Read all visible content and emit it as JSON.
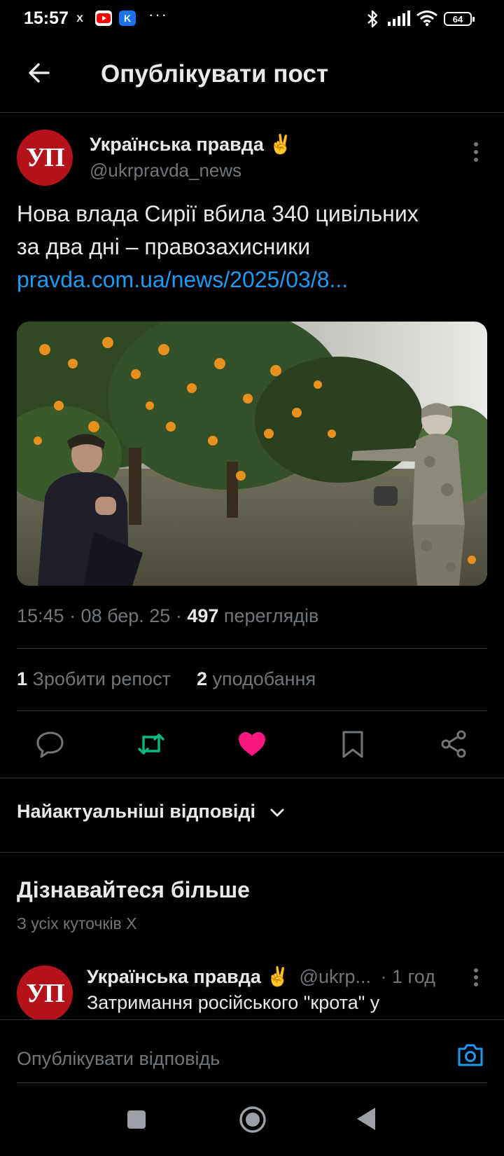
{
  "status_bar": {
    "time": "15:57",
    "apps": [
      "x-icon",
      "youtube-icon",
      "kyivstar-icon"
    ],
    "dots": "···",
    "battery": "64"
  },
  "header": {
    "title": "Опублікувати пост"
  },
  "post": {
    "avatar_text": "УП",
    "author_name": "Українська правда ✌️",
    "handle": "@ukrpravda_news",
    "text_line1": "Нова влада Сирії вбила 340 цивільних",
    "text_line2": "за два дні – правозахисники",
    "link": "pravda.com.ua/news/2025/03/8...",
    "time": "15:45 · 08 бер. 25 · ",
    "views_count": "497",
    "views_label": " переглядів",
    "reposts_count": "1",
    "reposts_label": " Зробити репост",
    "likes_count": "2",
    "likes_label": " уподобання",
    "liked": true,
    "colors": {
      "repost": "#00ba7c",
      "like": "#f91880",
      "link": "#1d9bf0"
    }
  },
  "replies": {
    "sort_label": "Найактуальніші відповіді"
  },
  "discover": {
    "title": "Дізнавайтеся більше",
    "subtitle": "З усіх куточків X",
    "item": {
      "avatar_text": "УП",
      "author_name": "Українська правда ✌️",
      "handle": "@ukrp...",
      "time": " · 1 год",
      "text": "Затримання російського \"крота\" у"
    }
  },
  "composer": {
    "placeholder": "Опублікувати відповідь"
  }
}
